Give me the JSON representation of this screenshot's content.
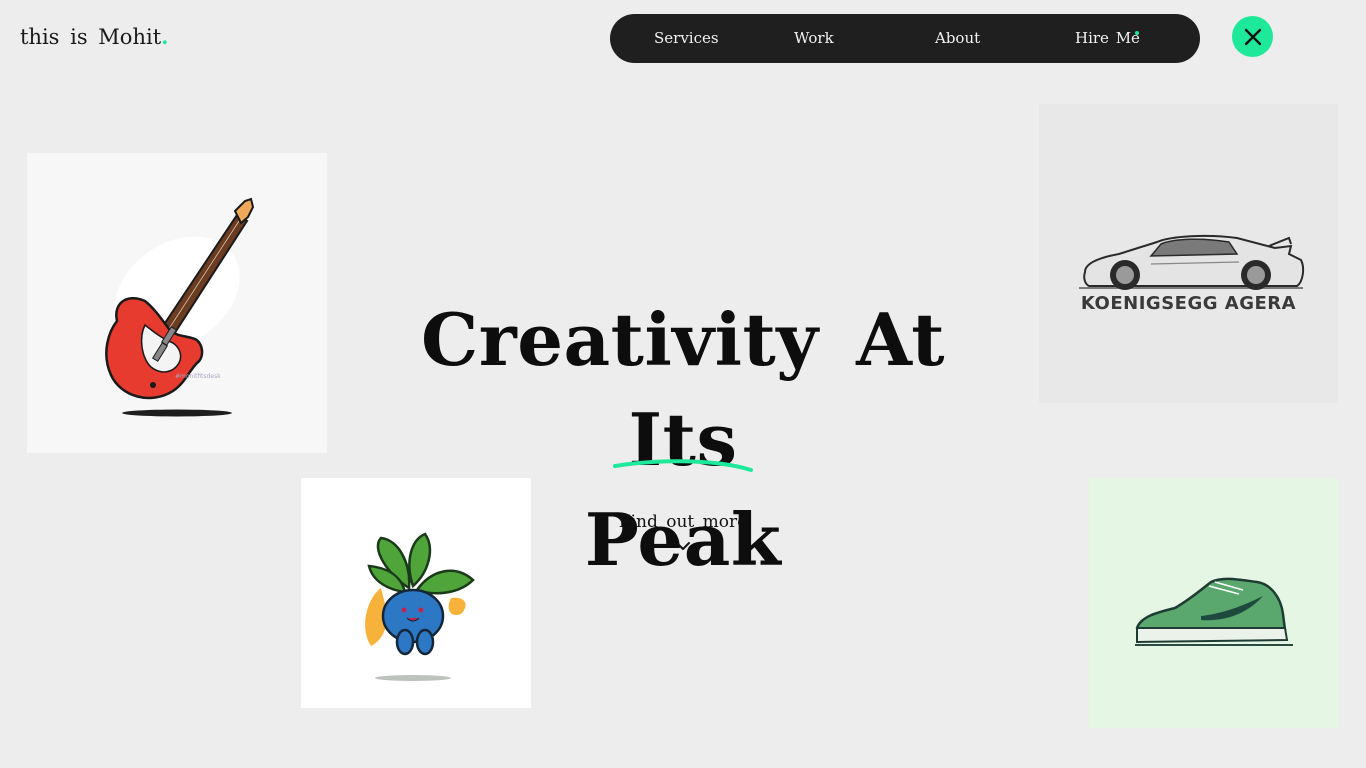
{
  "logo": {
    "text": "this is Mohit",
    "dot": "."
  },
  "nav": {
    "items": [
      {
        "label": "Services"
      },
      {
        "label": "Work"
      },
      {
        "label": "About"
      },
      {
        "label": "Hire Me"
      }
    ]
  },
  "close_button": {
    "icon": "close-icon"
  },
  "hero": {
    "headline_line1": "Creativity At Its",
    "headline_line2": "Peak",
    "cta": "Find out more",
    "cta_icon": "chevron-down-icon"
  },
  "gallery": {
    "guitar": {
      "signature": "#mohitfitsdesk"
    },
    "car": {
      "label": "KOENIGSEGG AGERA"
    },
    "plant": {},
    "shoe": {}
  },
  "colors": {
    "accent": "#1ee89a",
    "nav_bg": "#1f1f1f",
    "page_bg": "#ededed"
  }
}
